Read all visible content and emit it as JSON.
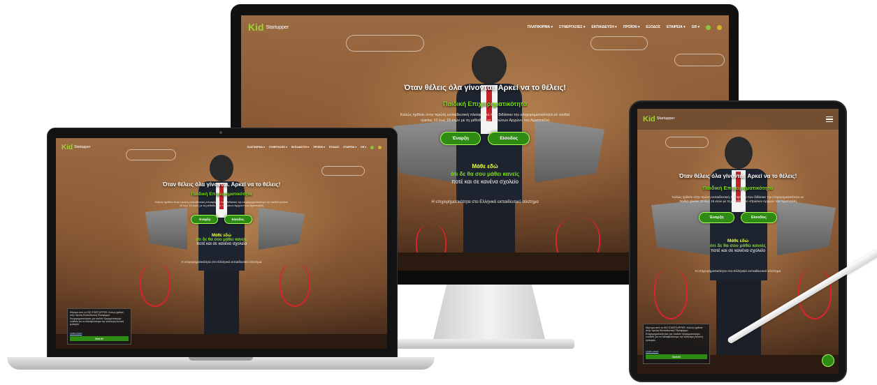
{
  "site": {
    "logo_main": "Kid",
    "logo_sub": "Startupper",
    "nav": [
      "ΠΛΑΤΦΟΡΜΑ ▾",
      "ΣΥΝΕΡΓΑΣΙΕΣ ▾",
      "ΕΚΠΑΙΔΕΥΣΗ ▾",
      "ΠΡΟΪΟΝ ▾",
      "ΕΞΟΔΟΣ",
      "ΕΤΑΙΡΕΙΑ ▾",
      "GR ▾"
    ],
    "hero_title": "Όταν θέλεις όλα γίνονται. Αρκεί να το θέλεις!",
    "hero_subtitle": "Παιδική Επιχειρηματικότητα",
    "hero_desc": "Καλώς ήρθατε στην πρώτη εκπαιδευτική πλατφόρμα που διδάσκει την επιχειρηματικότητα σε παιδιά ηλικίας 10 έως 15 ετών με τη μέθοδο των «Πρώτων Αρχών» του Αριστοτέλη",
    "btn_start": "Έναρξη",
    "btn_login": "Είσοδος",
    "learn_line1": "Μάθε εδώ",
    "learn_line2": "ότι δε θα σου μάθει κανείς",
    "learn_line3": "ποτέ και σε κανένα σχολείο",
    "footer_text": "Η επιχειρηματικότητα στο Ελληνικό εκπαιδευτικό σύστημα",
    "cookie_text": "Μήνυμα από το KID STARTUPPER. Καλώς ήρθατε στην πρώτη Εκπαιδευτική Πλατφόρμα Επιχειρηματικότητας για παιδιά! Χρησιμοποιούμε cookies για να διασφαλίσουμε την καλύτερη δυνατή εμπειρία.",
    "cookie_link": "Learn more",
    "cookie_button": "Got it!"
  },
  "colors": {
    "accent": "#7ddc1f",
    "button": "#2e8b14",
    "flame": "#d8252b"
  },
  "icons": [
    "hamburger-menu-icon",
    "chat-bubble-icon",
    "social-icon"
  ]
}
